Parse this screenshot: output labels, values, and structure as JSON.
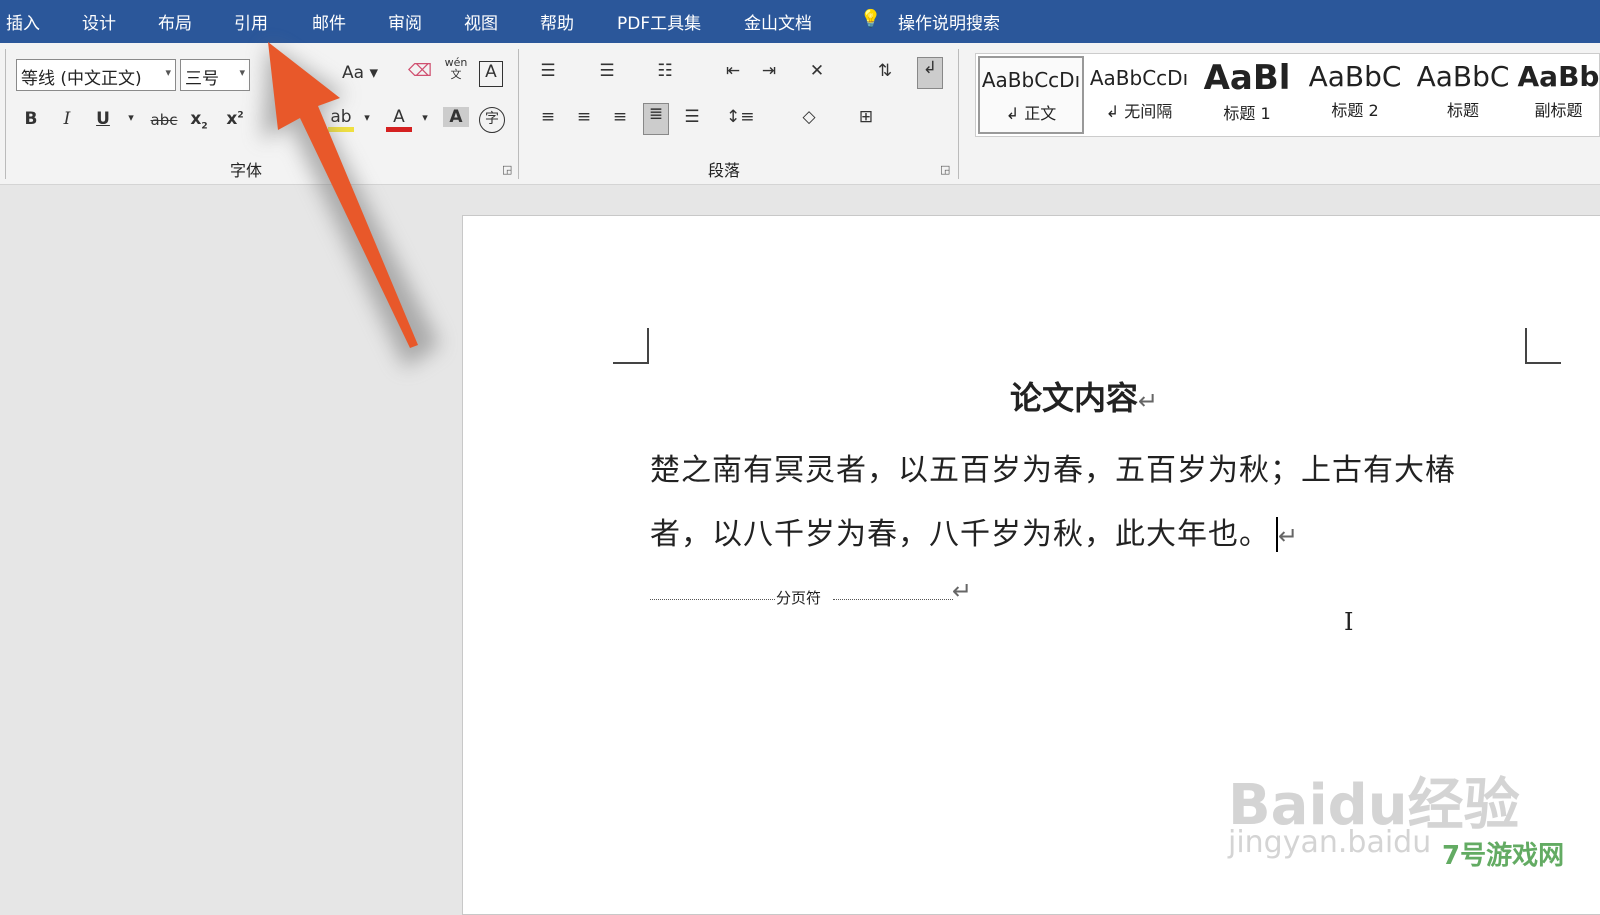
{
  "menu": [
    "插入",
    "设计",
    "布局",
    "引用",
    "邮件",
    "审阅",
    "视图",
    "帮助",
    "PDF工具集",
    "金山文档"
  ],
  "tell_me": {
    "icon": "lightbulb-icon",
    "label": "操作说明搜索"
  },
  "font": {
    "name": "等线 (中文正文)",
    "size": "三号",
    "group_label": "字体",
    "change_case": "Aa",
    "phonetic": "wén"
  },
  "paragraph": {
    "group_label": "段落"
  },
  "styles": [
    {
      "preview": "AaBbCcDı",
      "name": "↲ 正文",
      "selected": true
    },
    {
      "preview": "AaBbCcDı",
      "name": "↲ 无间隔"
    },
    {
      "preview": "AaBl",
      "name": "标题 1"
    },
    {
      "preview": "AaBbC",
      "name": "标题 2"
    },
    {
      "preview": "AaBbC",
      "name": "标题"
    },
    {
      "preview": "AaBb",
      "name": "副标题"
    }
  ],
  "document": {
    "title": "论文内容",
    "line1": "楚之南有冥灵者，以五百岁为春，五百岁为秋；上古有大椿",
    "line2": "者，以八千岁为春，八千岁为秋，此大年也。",
    "para_mark": "↵",
    "page_break": "分页符"
  },
  "annotation": {
    "arrow_color": "#e8582a"
  },
  "watermarks": {
    "baidu": "Baidu经验",
    "baidu_url": "jingyan.baidu",
    "site": "7号游戏网"
  },
  "colors": {
    "menubar": "#2b579a",
    "ribbon": "#f3f3f3",
    "font_color": "#d42020",
    "highlight": "#f0e040"
  }
}
